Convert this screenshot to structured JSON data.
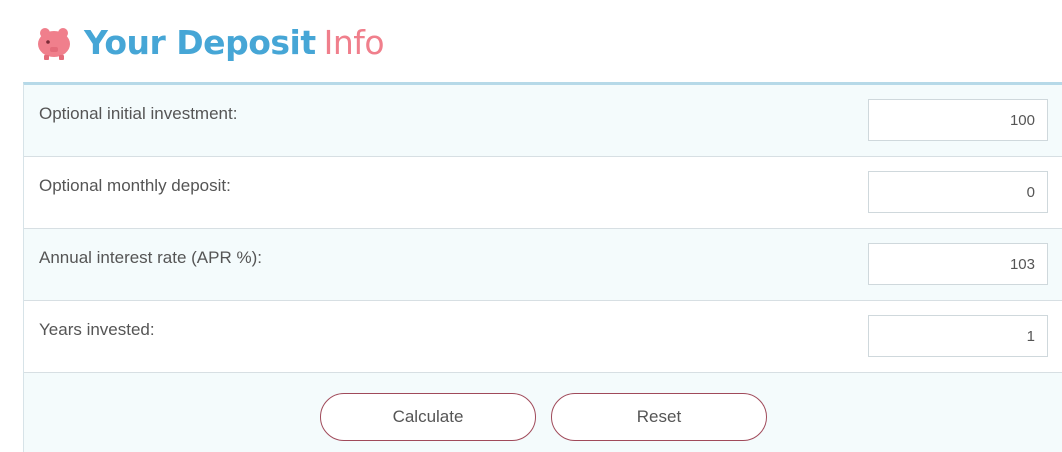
{
  "header": {
    "title_main": "Your Deposit",
    "title_accent": "Info",
    "icon": "piggy-bank-icon"
  },
  "colors": {
    "title_blue": "#46a6d6",
    "title_pink": "#f07f8c",
    "panel_border": "#b6d9e8",
    "button_border": "#a04a5a"
  },
  "form": {
    "rows": [
      {
        "label": "Optional initial investment:",
        "value": "100"
      },
      {
        "label": "Optional monthly deposit:",
        "value": "0"
      },
      {
        "label": "Annual interest rate (APR %):",
        "value": "103"
      },
      {
        "label": "Years invested:",
        "value": "1"
      }
    ]
  },
  "buttons": {
    "calculate": "Calculate",
    "reset": "Reset"
  }
}
